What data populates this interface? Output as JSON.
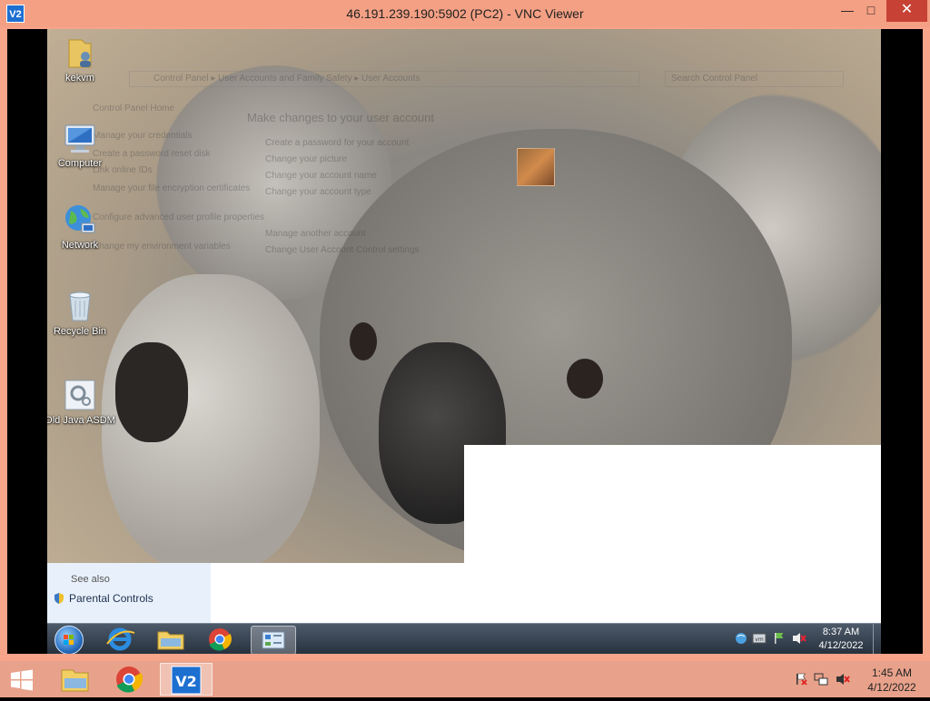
{
  "vnc": {
    "app_icon_text": "V2",
    "title": "46.191.239.190:5902 (PC2) - VNC Viewer",
    "min_glyph": "—",
    "max_glyph": "□",
    "close_glyph": "✕"
  },
  "desktop": {
    "icons": [
      {
        "label": "kekvm",
        "icon": "user-folder-icon"
      },
      {
        "label": "Computer",
        "icon": "computer-icon"
      },
      {
        "label": "Network",
        "icon": "network-globe-icon"
      },
      {
        "label": "Recycle Bin",
        "icon": "recycle-bin-icon"
      },
      {
        "label": "Old Java ASDM",
        "icon": "java-app-icon"
      }
    ]
  },
  "control_panel_ghost": {
    "address": "Control Panel ▸ User Accounts and Family Safety ▸ User Accounts",
    "search_placeholder": "Search Control Panel",
    "left_links": [
      "Control Panel Home",
      "Manage your credentials",
      "Create a password reset disk",
      "Link online IDs",
      "Manage your file encryption certificates",
      "Configure advanced user profile properties",
      "Change my environment variables"
    ],
    "heading": "Make changes to your user account",
    "right_links": [
      "Create a password for your account",
      "Change your picture",
      "Change your account name",
      "Change your account type",
      "Manage another account",
      "Change User Account Control settings"
    ]
  },
  "see_also": {
    "heading": "See also",
    "link": "Parental Controls"
  },
  "remote_taskbar": {
    "time": "8:37 AM",
    "date": "4/12/2022"
  },
  "local_taskbar": {
    "time": "1:45 AM",
    "date": "4/12/2022"
  },
  "colors": {
    "vnc_frame": "#f6a48a",
    "close_button": "#c74134",
    "local_taskbar": "#e8a28b"
  }
}
